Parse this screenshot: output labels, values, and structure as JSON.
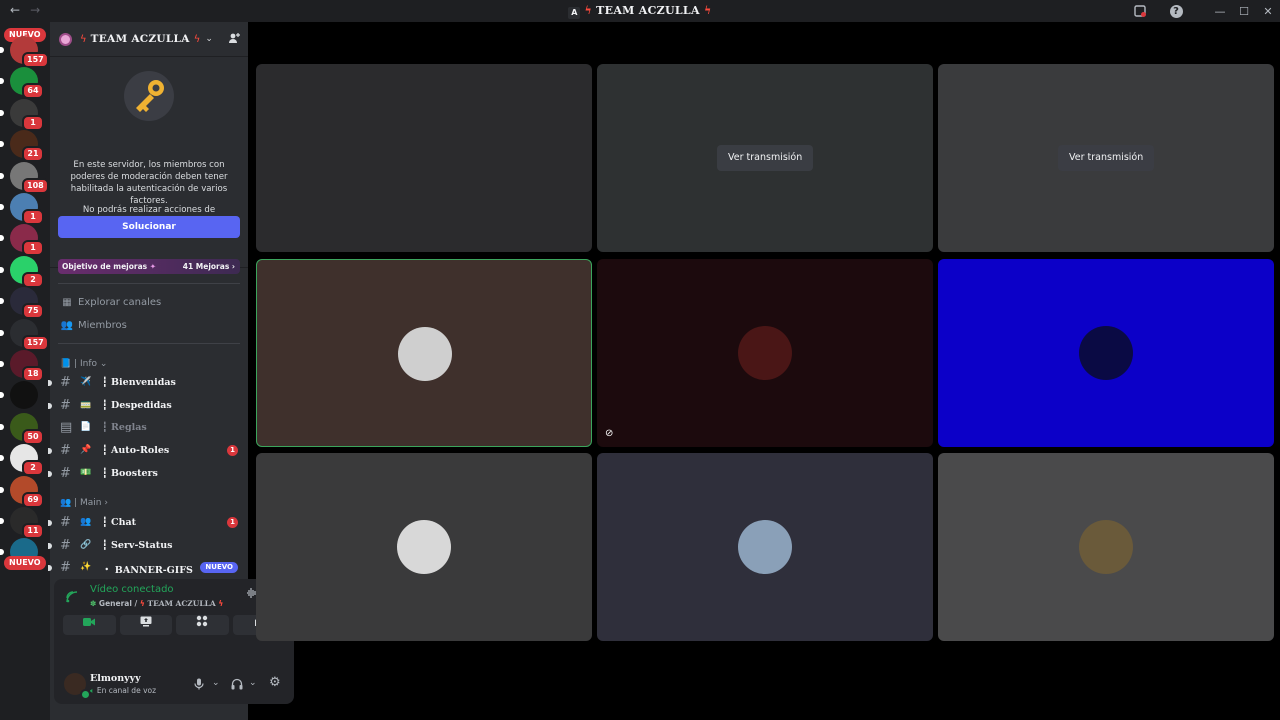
{
  "titlebar": {
    "back": "←",
    "forward": "→",
    "logo": "A",
    "title": "TEAM ACZULLA",
    "bolt": "ϟ",
    "window_controls": [
      "—",
      "☐",
      "✕"
    ],
    "icons": [
      "inbox-icon",
      "help-icon"
    ]
  },
  "guilds": {
    "top_badge": "NUEVO",
    "bottom_badge": "NUEVO",
    "items": [
      {
        "badge": "157",
        "color": "#b33a3a"
      },
      {
        "badge": "64",
        "color": "#1a8f3c"
      },
      {
        "badge": "1",
        "color": "#3a3a3a"
      },
      {
        "badge": "21",
        "color": "#4a2a1a"
      },
      {
        "badge": "108",
        "color": "#777777"
      },
      {
        "badge": "1",
        "color": "#4c7fb2"
      },
      {
        "badge": "1",
        "color": "#8a2a4a"
      },
      {
        "badge": "2",
        "color": "#2ad16a"
      },
      {
        "badge": "75",
        "color": "#2a2a3a"
      },
      {
        "badge": "157",
        "color": "#2b2d31"
      },
      {
        "badge": "18",
        "color": "#5a1a2a"
      },
      {
        "badge": "",
        "color": "#111111"
      },
      {
        "badge": "50",
        "color": "#3a5a1a"
      },
      {
        "badge": "2",
        "color": "#e6e6e6"
      },
      {
        "badge": "69",
        "color": "#b34a2a"
      },
      {
        "badge": "11",
        "color": "#2a2a2a"
      },
      {
        "badge": "",
        "color": "#1a6a8a"
      }
    ]
  },
  "sidebar": {
    "server_name": "TEAM ACZULLA",
    "notice_line1": "En este servidor, los miembros con poderes de moderación deben tener habilitada la autenticación de varios factores.",
    "notice_line2": "No podrás realizar acciones de moderación hasta que no la hayas habilitado.",
    "fix_button": "Solucionar",
    "boost_goal": {
      "label": "Objetivo de mejoras",
      "count": "41 Mejoras"
    },
    "nav": [
      {
        "icon": "compass-icon",
        "label": "Explorar canales"
      },
      {
        "icon": "members-icon",
        "label": "Miembros"
      }
    ],
    "categories": [
      {
        "label": "| Info",
        "emoji": "📘"
      },
      {
        "label": "| Main",
        "emoji": "👥"
      }
    ],
    "channels": [
      {
        "emoji": "✈️",
        "name": "┇ Bienvenidas",
        "badge": "",
        "muted": false,
        "unread": true
      },
      {
        "emoji": "🚃",
        "name": "┇ Despedidas",
        "badge": "",
        "muted": false,
        "unread": true
      },
      {
        "emoji": "📄",
        "name": "┇ Reglas",
        "badge": "",
        "muted": true,
        "unread": false
      },
      {
        "emoji": "📌",
        "name": "┇ Auto-Roles",
        "badge": "1",
        "muted": false,
        "unread": true
      },
      {
        "emoji": "💵",
        "name": "┇ Boosters",
        "badge": "",
        "muted": false,
        "unread": true
      },
      {
        "emoji": "👥",
        "name": "┇ Chat",
        "badge": "1",
        "muted": false,
        "unread": true
      },
      {
        "emoji": "🔗",
        "name": "┇ Serv-Status",
        "badge": "",
        "muted": false,
        "unread": true
      },
      {
        "emoji": "✨",
        "name": "・ BANNER-GIFS",
        "badge": "NUEVO",
        "muted": false,
        "unread": true
      }
    ]
  },
  "voice": {
    "status": "Vídeo conectado",
    "sub_channel": "General /",
    "sub_server": "TEAM ACZULLA"
  },
  "user": {
    "name": "Elmonyyy",
    "status": "En canal de voz"
  },
  "grid": {
    "watch_label": "Ver transmisión",
    "tiles": [
      {
        "bg": "#2b2b2d",
        "kind": "empty"
      },
      {
        "bg": "#2e3132",
        "kind": "stream"
      },
      {
        "bg": "#3a3b3d",
        "kind": "stream"
      },
      {
        "bg": "#3f302c",
        "kind": "avatar",
        "avatar_bg": "#cfcfcf",
        "speaking": true
      },
      {
        "bg": "#1c0a0d",
        "kind": "avatar",
        "avatar_bg": "#4a1616",
        "muted": true
      },
      {
        "bg": "#0c00c8",
        "kind": "avatar",
        "avatar_bg": "#0a0a44"
      },
      {
        "bg": "#3a3a3b",
        "kind": "avatar",
        "avatar_bg": "#d8d8d8"
      },
      {
        "bg": "#2f2f3b",
        "kind": "avatar",
        "avatar_bg": "#8aa0b8"
      },
      {
        "bg": "#4a4a4b",
        "kind": "avatar",
        "avatar_bg": "#6a5a3a"
      }
    ]
  }
}
